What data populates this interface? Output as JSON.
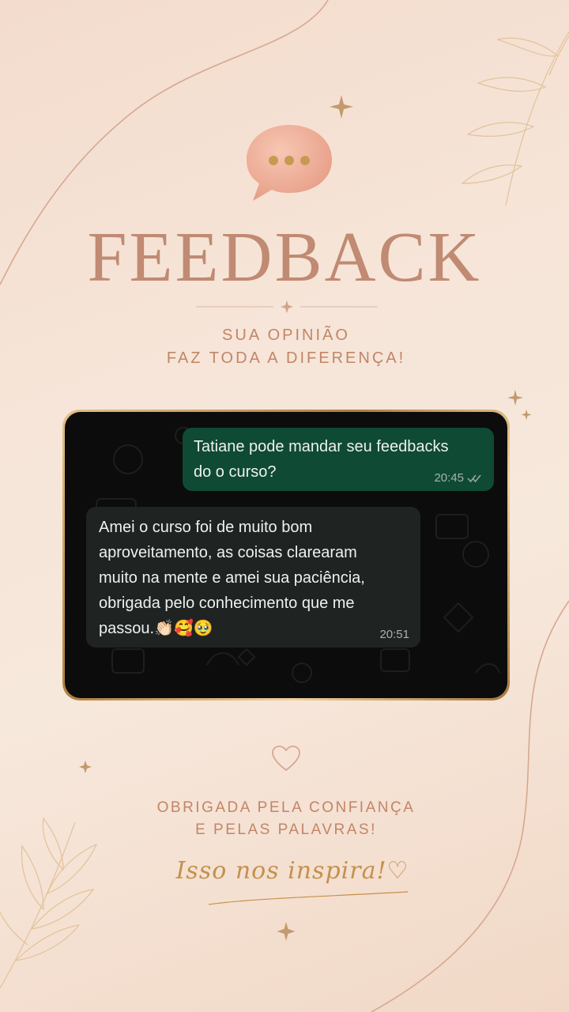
{
  "header": {
    "title": "FEEDBACK",
    "subtitle_line1": "SUA OPINIÃO",
    "subtitle_line2": "FAZ TODA A DIFERENÇA!"
  },
  "chat": {
    "sent": {
      "text": "Tatiane pode mandar seu feedbacks\ndo o curso?",
      "time": "20:45"
    },
    "received": {
      "text": "Amei o curso foi de muito bom\naproveitamento, as coisas clarearam\nmuito na mente  e amei sua paciência,\nobrigada pelo conhecimento que me\npassou.",
      "emojis": "👏🏻🥰🥹",
      "time": "20:51"
    }
  },
  "footer": {
    "thanks_line1": "OBRIGADA PELA CONFIANÇA",
    "thanks_line2": "E PELAS PALAVRAS!",
    "script": "Isso nos inspira!♡"
  },
  "colors": {
    "accent": "#c08a73",
    "gold": "#c4904c",
    "chat_sent": "#0f4a34",
    "chat_received": "#1f2321"
  }
}
